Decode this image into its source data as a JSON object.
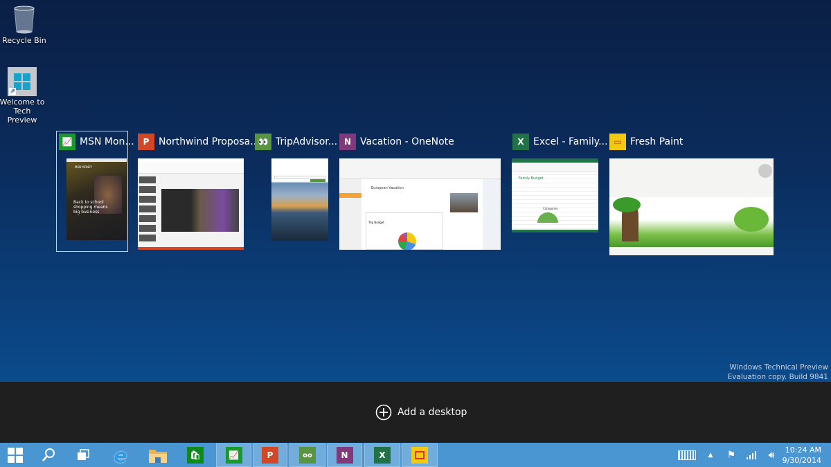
{
  "desktop_icons": [
    {
      "label": "Recycle Bin",
      "icon": "recycle-bin-icon"
    },
    {
      "label": "Welcome to Tech Preview",
      "icon": "windows-logo-icon"
    }
  ],
  "windows": [
    {
      "title": "MSN Mon...",
      "icon": "msn-money-icon",
      "color": "#1a9a2e",
      "selected": true
    },
    {
      "title": "Northwind Proposa...",
      "icon": "powerpoint-icon",
      "color": "#d24726"
    },
    {
      "title": "TripAdvisor...",
      "icon": "tripadvisor-icon",
      "color": "#589442"
    },
    {
      "title": "Vacation - OneNote",
      "icon": "onenote-icon",
      "color": "#80397b"
    },
    {
      "title": "Excel - Family...",
      "icon": "excel-icon",
      "color": "#217346"
    },
    {
      "title": "Fresh Paint",
      "icon": "fresh-paint-icon",
      "color": "#f2c811"
    }
  ],
  "thumbs": {
    "msn": "MSN MONEY",
    "msn_head": "Back to school shopping means big business",
    "onenote_page": "European Vacation",
    "onenote_sub": "Trip Budget",
    "excel_title": "Family Budget",
    "excel_chart": "Categories"
  },
  "watermark": {
    "line1": "Windows Technical Preview",
    "line2": "Evaluation copy. Build 9841"
  },
  "add_desktop": "Add a desktop",
  "taskbar": {
    "pinned": [
      "start",
      "search",
      "task-view",
      "internet-explorer",
      "file-explorer",
      "store"
    ],
    "open": [
      "msn-money",
      "powerpoint",
      "tripadvisor",
      "onenote",
      "excel",
      "fresh-paint"
    ],
    "time": "10:24 AM",
    "date": "9/30/2014"
  },
  "colors": {
    "taskbar": "#4a96d2",
    "band": "#1f1f1f",
    "desktop": "#0b2d5e"
  }
}
